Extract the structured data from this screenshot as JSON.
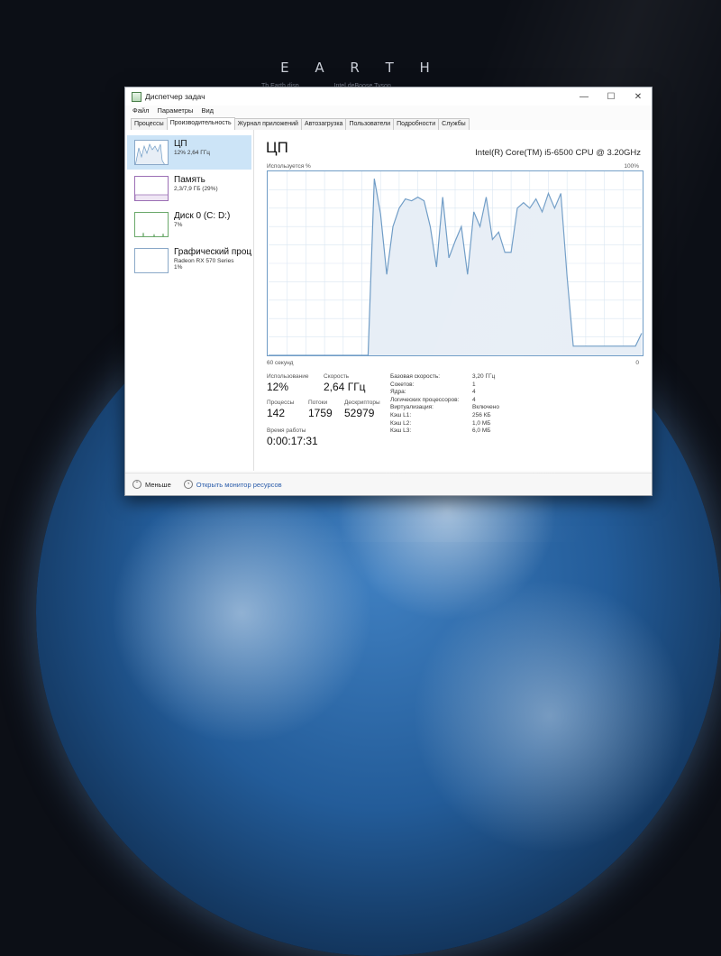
{
  "wallpaper": {
    "title": "E A R T H",
    "subtitle": "Th Earth disp... ... ... ... ... Intel deBoose Tyson"
  },
  "window": {
    "title": "Диспетчер задач",
    "controls": {
      "minimize": "—",
      "maximize": "☐",
      "close": "✕"
    },
    "menu": [
      "Файл",
      "Параметры",
      "Вид"
    ],
    "tabs": [
      {
        "label": "Процессы",
        "active": false
      },
      {
        "label": "Производительность",
        "active": true
      },
      {
        "label": "Журнал приложений",
        "active": false
      },
      {
        "label": "Автозагрузка",
        "active": false
      },
      {
        "label": "Пользователи",
        "active": false
      },
      {
        "label": "Подробности",
        "active": false
      },
      {
        "label": "Службы",
        "active": false
      }
    ]
  },
  "sidebar": {
    "items": [
      {
        "name": "ЦП",
        "sub": "12% 2,64 ГГц",
        "selected": true
      },
      {
        "name": "Память",
        "sub": "2,3/7,9 ГБ (29%)",
        "selected": false
      },
      {
        "name": "Диск 0 (C: D:)",
        "sub": "7%",
        "selected": false
      },
      {
        "name": "Графический проц",
        "sub": "Radeon RX 570 Series\n1%",
        "selected": false
      }
    ]
  },
  "cpu": {
    "title": "ЦП",
    "model": "Intel(R) Core(TM) i5-6500 CPU @ 3.20GHz",
    "graph_label": "Используется %",
    "graph_max": "100%",
    "graph_time": "60 секунд",
    "graph_min": "0",
    "usage_label": "Использование",
    "usage": "12%",
    "speed_label": "Скорость",
    "speed": "2,64 ГГц",
    "processes_label": "Процессы",
    "processes": "142",
    "threads_label": "Потоки",
    "threads": "1759",
    "handles_label": "Дескрипторы",
    "handles": "52979",
    "uptime_label": "Время работы",
    "uptime": "0:00:17:31"
  },
  "specs": [
    {
      "k": "Базовая скорость:",
      "v": "3,20 ГГц"
    },
    {
      "k": "Сокетов:",
      "v": "1"
    },
    {
      "k": "Ядра:",
      "v": "4"
    },
    {
      "k": "Логических процессоров:",
      "v": "4"
    },
    {
      "k": "Виртуализация:",
      "v": "Включено"
    },
    {
      "k": "Кэш L1:",
      "v": "256 КБ"
    },
    {
      "k": "Кэш L2:",
      "v": "1,0 МБ"
    },
    {
      "k": "Кэш L3:",
      "v": "6,0 МБ"
    }
  ],
  "footer": {
    "less": "Меньше",
    "monitor": "Открыть монитор ресурсов"
  },
  "colors": {
    "graph_line": "#6f9cc6",
    "graph_fill": "#e7eef6",
    "grid": "#d9e6f2",
    "selected": "#cce4f7"
  },
  "chart_data": {
    "type": "area",
    "ylim": [
      0,
      100
    ],
    "x": [
      0,
      1,
      2,
      3,
      4,
      5,
      6,
      7,
      8,
      9,
      10,
      11,
      12,
      13,
      14,
      15,
      16,
      17,
      18,
      19,
      20,
      21,
      22,
      23,
      24,
      25,
      26,
      27,
      28,
      29,
      30,
      31,
      32,
      33,
      34,
      35,
      36,
      37,
      38,
      39,
      40,
      41,
      42,
      43,
      44,
      45,
      46,
      47,
      48,
      49,
      50,
      51,
      52,
      53,
      54,
      55,
      56,
      57,
      58,
      59,
      60
    ],
    "values": [
      0,
      0,
      0,
      0,
      0,
      0,
      0,
      0,
      0,
      0,
      0,
      0,
      0,
      0,
      0,
      0,
      0,
      96,
      77,
      44,
      70,
      80,
      85,
      84,
      86,
      84,
      70,
      48,
      86,
      53,
      62,
      70,
      44,
      78,
      70,
      86,
      63,
      67,
      56,
      56,
      80,
      83,
      80,
      85,
      78,
      88,
      80,
      88,
      43,
      5,
      5,
      5,
      5,
      5,
      5,
      5,
      5,
      5,
      5,
      5,
      12
    ]
  }
}
